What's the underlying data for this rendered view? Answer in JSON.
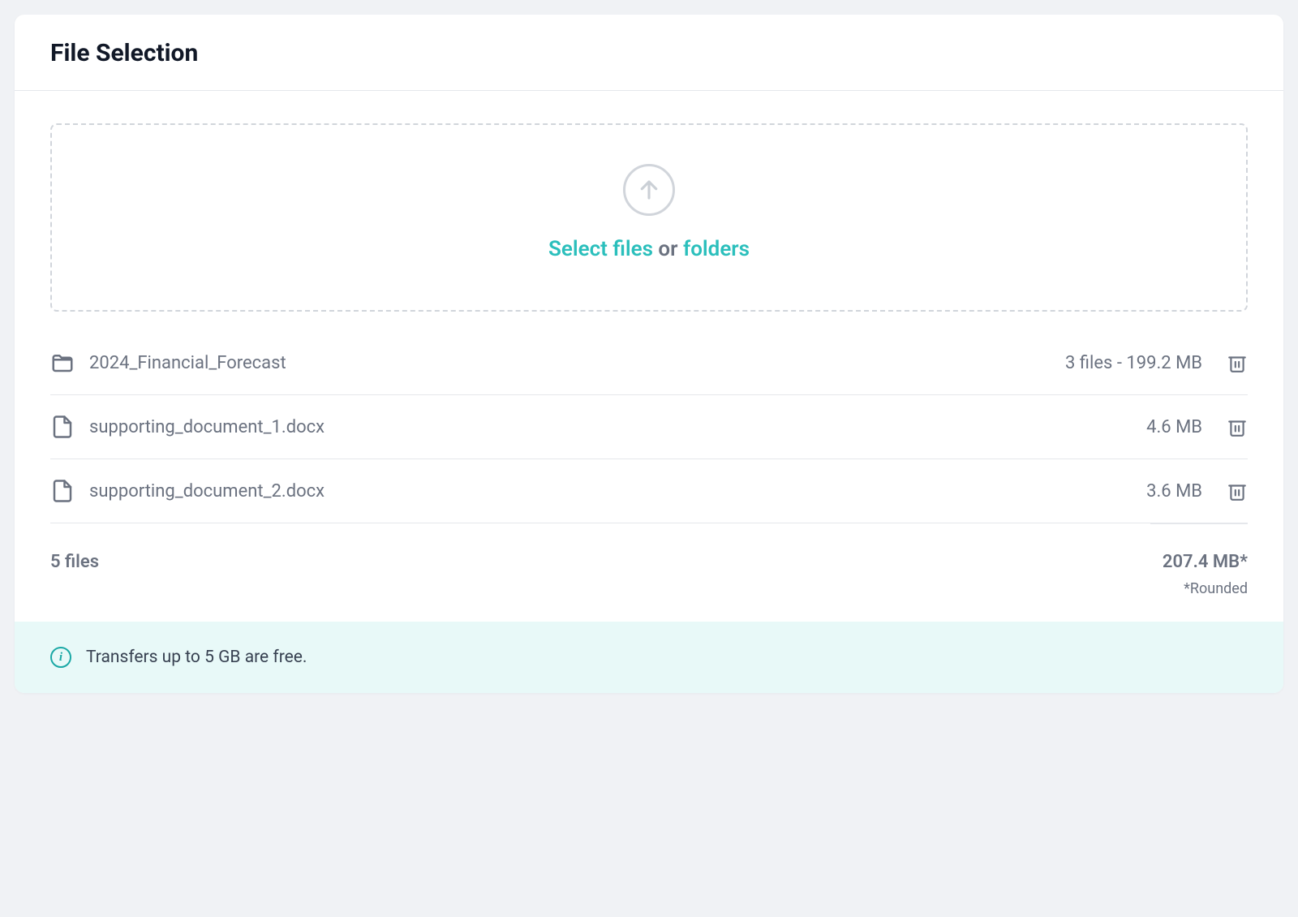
{
  "header": {
    "title": "File Selection"
  },
  "dropzone": {
    "select_files_label": "Select files",
    "or_label": " or ",
    "folders_label": "folders"
  },
  "files": [
    {
      "type": "folder",
      "name": "2024_Financial_Forecast",
      "meta": "3 files - 199.2 MB"
    },
    {
      "type": "file",
      "name": "supporting_document_1.docx",
      "meta": "4.6 MB"
    },
    {
      "type": "file",
      "name": "supporting_document_2.docx",
      "meta": "3.6 MB"
    }
  ],
  "summary": {
    "count_label": "5 files",
    "total_size": "207.4 MB*",
    "rounded_note": "*Rounded"
  },
  "banner": {
    "text": "Transfers up to 5 GB are free."
  }
}
